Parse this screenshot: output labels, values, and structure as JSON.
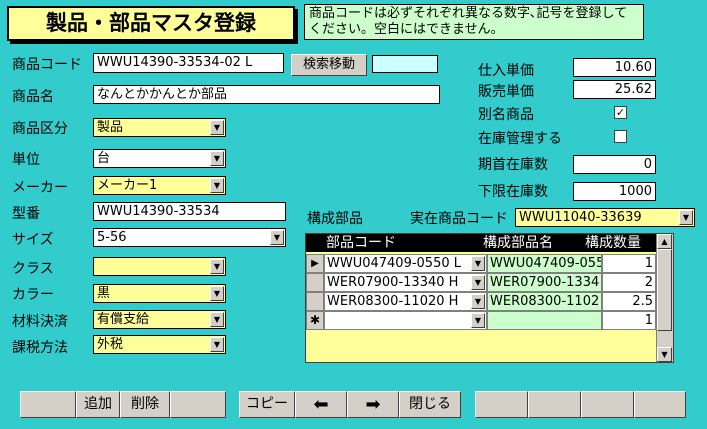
{
  "title": "製品・部品マスタ登録",
  "note": "商品コードは必ずそれぞれ異なる数字､記号を登録してください。空白にはできません。",
  "left_fields": {
    "code_label": "商品コード",
    "code_value": "WWU14390-33534-02 L",
    "search_button": "検索移動",
    "search_extra": "",
    "name_label": "商品名",
    "name_value": "なんとかかんとか部品",
    "category_label": "商品区分",
    "category_value": "製品",
    "unit_label": "単位",
    "unit_value": "台",
    "maker_label": "メーカー",
    "maker_value": "メーカー1",
    "model_label": "型番",
    "model_value": "WWU14390-33534",
    "size_label": "サイズ",
    "size_value": "5-56",
    "class_label": "クラス",
    "class_value": "",
    "color_label": "カラー",
    "color_value": "黒",
    "material_label": "材料決済",
    "material_value": "有償支給",
    "tax_label": "課税方法",
    "tax_value": "外税"
  },
  "right_fields": {
    "purchase_label": "仕入単価",
    "purchase_value": "10.60",
    "sale_label": "販売単価",
    "sale_value": "25.62",
    "alias_label": "別名商品",
    "alias_checked": "✓",
    "stock_manage_label": "在庫管理する",
    "stock_manage_checked": "",
    "opening_label": "期首在庫数",
    "opening_value": "0",
    "min_label": "下限在庫数",
    "min_value": "1000"
  },
  "parts": {
    "label": "構成部品",
    "actual_label": "実在商品コード",
    "actual_value": "WWU11040-33639",
    "headers": [
      "部品コード",
      "構成部品名",
      "構成数量"
    ],
    "rows": [
      {
        "code": "WWU047409-0550 L",
        "name": "WWU047409-055",
        "qty": "1"
      },
      {
        "code": "WER07900-13340 H",
        "name": "WER07900-1334",
        "qty": "2"
      },
      {
        "code": "WER08300-11020 H",
        "name": "WER08300-1102",
        "qty": "2.5"
      },
      {
        "code": "",
        "name": "",
        "qty": "1"
      }
    ]
  },
  "bottom": {
    "add": "追加",
    "delete": "削除",
    "copy": "コピー",
    "prev": "⬅",
    "next": "➡",
    "close": "閉じる"
  }
}
